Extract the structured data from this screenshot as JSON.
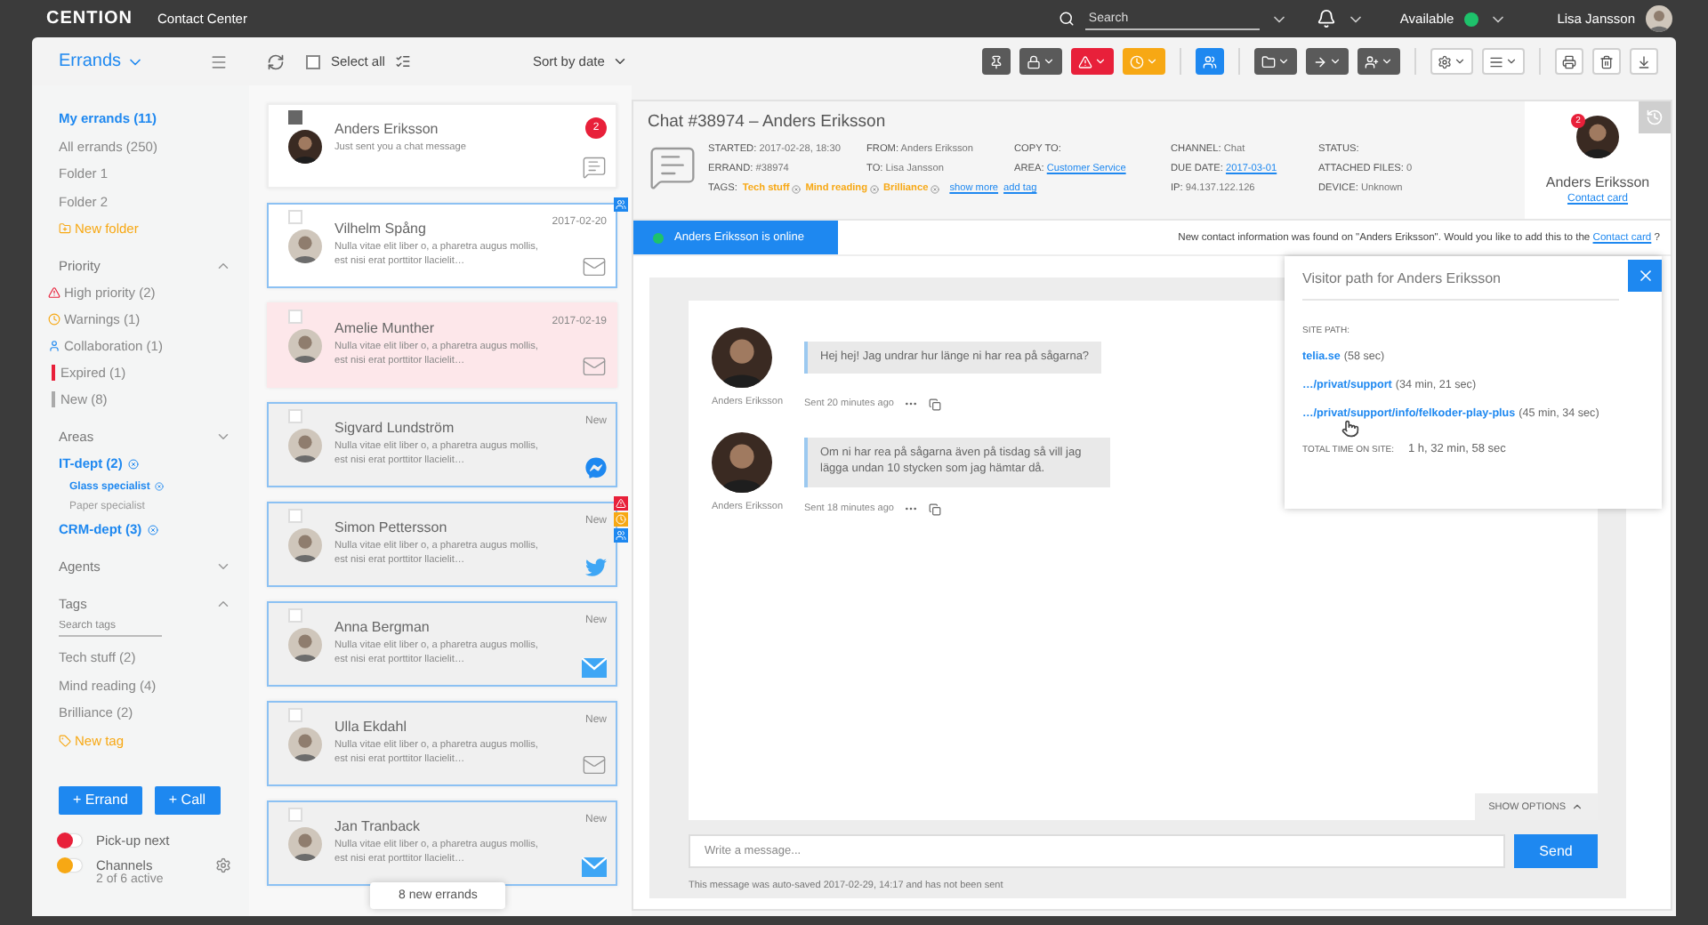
{
  "topbar": {
    "brand": "CENTION",
    "product": "Contact Center",
    "search": {
      "placeholder": "Search"
    },
    "status": {
      "label": "Available"
    },
    "user": "Lisa Jansson"
  },
  "toolbar": {
    "view": "Errands",
    "select_all": {
      "label": "Select all",
      "checked": false
    },
    "sort": "Sort by date",
    "action_groups": [
      [
        {
          "kind": "pin",
          "color": "#5a5a5a",
          "dropdown": false
        },
        {
          "kind": "lock",
          "color": "#5a5a5a",
          "dropdown": true
        },
        {
          "kind": "warning",
          "color": "#e8203a",
          "dropdown": true
        },
        {
          "kind": "clock",
          "color": "#f7a814",
          "dropdown": true
        }
      ],
      [
        {
          "kind": "collab",
          "color": "#1e88f0",
          "dropdown": false
        }
      ],
      [
        {
          "kind": "folder",
          "color": "#5a5a5a",
          "dropdown": true
        },
        {
          "kind": "forward",
          "color": "#5a5a5a",
          "dropdown": true
        },
        {
          "kind": "assign",
          "color": "#5a5a5a",
          "dropdown": true
        }
      ],
      [
        {
          "kind": "settings",
          "color": "#ffffff",
          "dropdown": true
        },
        {
          "kind": "list",
          "color": "#ffffff",
          "dropdown": true
        }
      ],
      [
        {
          "kind": "print",
          "color": "#ffffff",
          "dropdown": false
        },
        {
          "kind": "trash",
          "color": "#ffffff",
          "dropdown": false
        },
        {
          "kind": "download",
          "color": "#ffffff",
          "dropdown": false
        }
      ]
    ]
  },
  "sidebar": {
    "folders": [
      {
        "label": "My errands (11)",
        "selected": true
      },
      {
        "label": "All errands (250)",
        "selected": false
      },
      {
        "label": "Folder 1",
        "selected": false
      },
      {
        "label": "Folder 2",
        "selected": false
      }
    ],
    "new_folder": "New folder",
    "sections": [
      {
        "kind": "priority",
        "title": "Priority",
        "expanded": true,
        "items": [
          {
            "label": "High priority (2)",
            "kind": "warning"
          },
          {
            "label": "Warnings (1)",
            "kind": "clock"
          },
          {
            "label": "Collaboration (1)",
            "kind": "collab"
          },
          {
            "label": "Expired (1)",
            "kind": "expired"
          },
          {
            "label": "New (8)",
            "kind": "new"
          }
        ]
      },
      {
        "kind": "areas",
        "title": "Areas",
        "expanded": false,
        "items": [
          {
            "label": "IT-dept (2)",
            "selected": true,
            "children": [
              {
                "label": "Glass specialist",
                "selected": true
              },
              {
                "label": "Paper specialist",
                "selected": false
              }
            ]
          },
          {
            "label": "CRM-dept (3)",
            "selected": true
          }
        ]
      },
      {
        "kind": "agents",
        "title": "Agents",
        "expanded": false
      },
      {
        "kind": "tags",
        "title": "Tags",
        "expanded": true,
        "placeholder": "Search tags",
        "items": [
          {
            "label": "Tech stuff (2)"
          },
          {
            "label": "Mind reading (4)"
          },
          {
            "label": "Brilliance (2)"
          }
        ],
        "new_tag": "New tag"
      }
    ],
    "buttons": [
      "+ Errand",
      "+ Call"
    ],
    "switches": [
      {
        "label": "Pick-up next",
        "color": "#e8203a"
      },
      {
        "label": "Channels",
        "color": "#f7a814",
        "detail": "2 of 6 active"
      }
    ]
  },
  "errands": [
    {
      "name": "Anders Eriksson",
      "preview": "Just sent you a chat message",
      "kind": "current",
      "checked": true,
      "badge": "2",
      "channel": {
        "kind": "chat",
        "unread": false
      }
    },
    {
      "name": "Vilhelm Spång",
      "preview": "Nulla vitae elit liber o, a pharetra augus mollis, est nisi erat porttitor llacielit…",
      "stamp": "2017-02-20",
      "kind": "open",
      "checked": false,
      "channel": {
        "kind": "email",
        "unread": false
      },
      "flags": [
        {
          "kind": "collab"
        }
      ]
    },
    {
      "name": "Amelie Munther",
      "preview": "Nulla vitae elit liber o, a pharetra augus mollis, est nisi erat porttitor llacielit…",
      "stamp": "2017-02-19",
      "kind": "expired",
      "checked": false,
      "channel": {
        "kind": "email",
        "unread": false
      }
    },
    {
      "name": "Sigvard Lundström",
      "preview": "Nulla vitae elit liber o, a pharetra augus mollis, est nisi erat porttitor llacielit…",
      "stamp": "New",
      "kind": "new",
      "checked": false,
      "channel": {
        "kind": "messenger",
        "unread": true
      }
    },
    {
      "name": "Simon Pettersson",
      "preview": "Nulla vitae elit liber o, a pharetra augus mollis, est nisi erat porttitor llacielit…",
      "stamp": "New",
      "kind": "new",
      "checked": false,
      "channel": {
        "kind": "twitter",
        "unread": true
      },
      "flags": [
        {
          "kind": "warning"
        },
        {
          "kind": "clock"
        },
        {
          "kind": "collab"
        }
      ]
    },
    {
      "name": "Anna Bergman",
      "preview": "Nulla vitae elit liber o, a pharetra augus mollis, est nisi erat porttitor llacielit…",
      "stamp": "New",
      "kind": "new",
      "checked": false,
      "channel": {
        "kind": "email",
        "unread": true
      }
    },
    {
      "name": "Ulla Ekdahl",
      "preview": "Nulla vitae elit liber o, a pharetra augus mollis, est nisi erat porttitor llacielit…",
      "stamp": "New",
      "kind": "new",
      "checked": false,
      "channel": {
        "kind": "email",
        "unread": false
      }
    },
    {
      "name": "Jan Tranback",
      "preview": "Nulla vitae elit liber o, a pharetra augus mollis, est nisi erat porttitor llacielit…",
      "stamp": "New",
      "kind": "new",
      "checked": false,
      "channel": {
        "kind": "email",
        "unread": true
      }
    }
  ],
  "toast": "8 new errands",
  "chat": {
    "title": "Chat #38974 – Anders Eriksson",
    "fields": [
      {
        "label": "STARTED:",
        "value": "2017-02-28, 18:30"
      },
      {
        "label": "FROM:",
        "value": "Anders Eriksson"
      },
      {
        "label": "COPY TO:"
      },
      {
        "label": "CHANNEL:",
        "value": "Chat"
      },
      {
        "label": "STATUS:"
      },
      {
        "label": "ERRAND:",
        "value": "#38974"
      },
      {
        "label": "TO:",
        "value": "Lisa Jansson"
      },
      {
        "label": "AREA:",
        "value": "Customer Service",
        "link": true
      },
      {
        "label": "DUE DATE:",
        "value": "2017-03-01",
        "link": true
      },
      {
        "label": "ATTACHED FILES:",
        "value": "0"
      },
      {
        "label": "IP:",
        "value": "94.137.122.126"
      },
      {
        "label": "DEVICE:",
        "value": "Unknown"
      }
    ],
    "tags": {
      "label": "TAGS:",
      "items": [
        "Tech stuff",
        "Mind reading",
        "Brilliance"
      ],
      "show_more": "show more",
      "add_tag": "add tag"
    },
    "contact": {
      "name": "Anders Eriksson",
      "badge": "2",
      "link": "Contact card"
    },
    "online": "Anders Eriksson is online",
    "notice": {
      "before": "New contact information was found on \"Anders Eriksson\". Would you like to add this to the",
      "link": "Contact card",
      "after": "?"
    },
    "messages": [
      {
        "author": "Anders Eriksson",
        "text": "Hej hej! Jag undrar hur länge ni har rea på sågarna?",
        "time": "Sent 20 minutes ago"
      },
      {
        "author": "Anders Eriksson",
        "text": "Om ni har rea på sågarna även på tisdag så vill jag lägga undan 10 stycken som jag hämtar då.",
        "time": "Sent 18 minutes ago"
      }
    ],
    "show_options": "SHOW OPTIONS",
    "composer": {
      "placeholder": "Write a message...",
      "send": "Send",
      "autosave": "This message was auto-saved 2017-02-29, 14:17 and has not been sent"
    }
  },
  "visitor_path": {
    "title": "Visitor path for Anders Eriksson",
    "label": "SITE PATH:",
    "entries": [
      {
        "url": "telia.se",
        "duration": "(58 sec)"
      },
      {
        "url": "…/privat/support",
        "duration": "(34 min, 21 sec)"
      },
      {
        "url": "…/privat/support/info/felkoder-play-plus",
        "duration": "(45 min, 34 sec)"
      }
    ],
    "total_label": "TOTAL TIME ON SITE:",
    "total": "1 h, 32 min, 58 sec"
  }
}
